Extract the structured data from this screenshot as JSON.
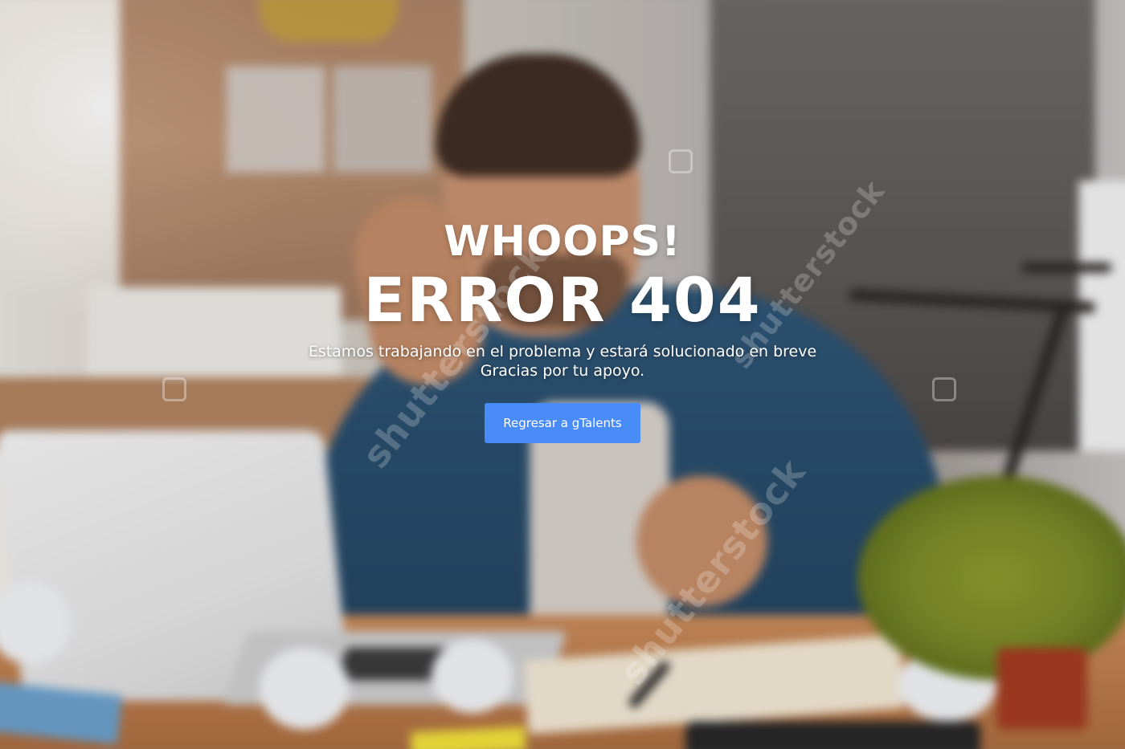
{
  "hero": {
    "title": "WHOOPS!",
    "error_code": "ERROR 404",
    "message_line_1": "Estamos trabajando en el problema y estará solucionado en breve",
    "message_line_2": "Gracias por tu apoyo.",
    "back_button_label": "Regresar a gTalents",
    "button_color": "#4a8cf7",
    "text_color": "#ffffff"
  },
  "background": {
    "description_icon": "office-photo",
    "watermark_text": "shutterstock"
  }
}
